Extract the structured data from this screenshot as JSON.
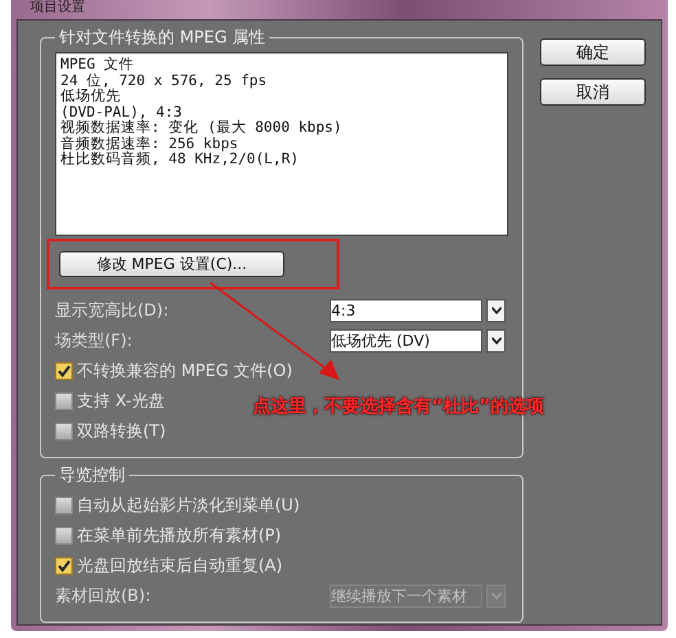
{
  "window": {
    "title": "项目设置"
  },
  "buttons": [
    {
      "label": "确定"
    },
    {
      "label": "取消"
    }
  ],
  "groups": [
    {
      "title": "针对文件转换的 MPEG 属性",
      "summary": [
        "MPEG 文件",
        "24 位, 720 x 576, 25 fps",
        "低场优先",
        "(DVD-PAL),  4:3",
        "视频数据速率: 变化 (最大  8000 kbps)",
        "音频数据速率: 256 kbps",
        "杜比数码音频, 48 KHz,2/0(L,R)"
      ],
      "action_button": {
        "label": "修改 MPEG 设置(C)...",
        "highlighted": true
      },
      "items": [
        {
          "kind": "dropdown",
          "label": "显示宽高比(D):",
          "value": "4:3",
          "disabled": false
        },
        {
          "kind": "dropdown",
          "label": "场类型(F):",
          "value": "低场优先 (DV)",
          "disabled": false
        },
        {
          "kind": "checkbox",
          "label": "不转换兼容的 MPEG 文件(O)",
          "checked": true
        },
        {
          "kind": "checkbox",
          "label": "支持 X-光盘",
          "checked": false
        },
        {
          "kind": "checkbox",
          "label": "双路转换(T)",
          "checked": false
        }
      ]
    },
    {
      "title": "导览控制",
      "items": [
        {
          "kind": "checkbox",
          "label": "自动从起始影片淡化到菜单(U)",
          "checked": false
        },
        {
          "kind": "checkbox",
          "label": "在菜单前先播放所有素材(P)",
          "checked": false
        },
        {
          "kind": "checkbox",
          "label": "光盘回放结束后自动重复(A)",
          "checked": true
        },
        {
          "kind": "dropdown",
          "label": "素材回放(B):",
          "value": "继续播放下一个素材",
          "disabled": true
        }
      ]
    }
  ],
  "annotation": {
    "text": "点这里，不要选择含有“杜比”的选项"
  }
}
